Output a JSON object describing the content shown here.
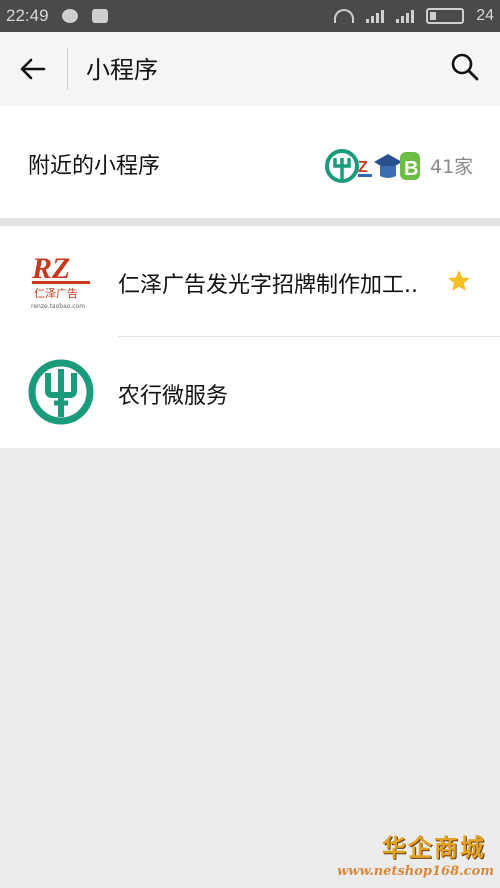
{
  "status_bar": {
    "time": "22:49",
    "battery": "24"
  },
  "nav": {
    "title": "小程序",
    "back_icon": "arrow-left-icon",
    "search_icon": "search-icon"
  },
  "nearby": {
    "label": "附近的小程序",
    "count": "41家"
  },
  "mini_programs": [
    {
      "label": "仁泽广告发光字招牌制作加工..",
      "icon": "renze-logo",
      "starred": true
    },
    {
      "label": "农行微服务",
      "icon": "abc-bank-logo",
      "starred": false
    }
  ],
  "logos": {
    "renze_text": "RZ",
    "renze_sub": "仁泽广告",
    "renze_url": "renze.taobao.com"
  },
  "watermark": {
    "brand": "华企商城",
    "url": "www.netshop168.com"
  },
  "colors": {
    "abc_green": "#1a9b7c",
    "star": "#f6c025",
    "renze_red": "#c83a1e"
  }
}
